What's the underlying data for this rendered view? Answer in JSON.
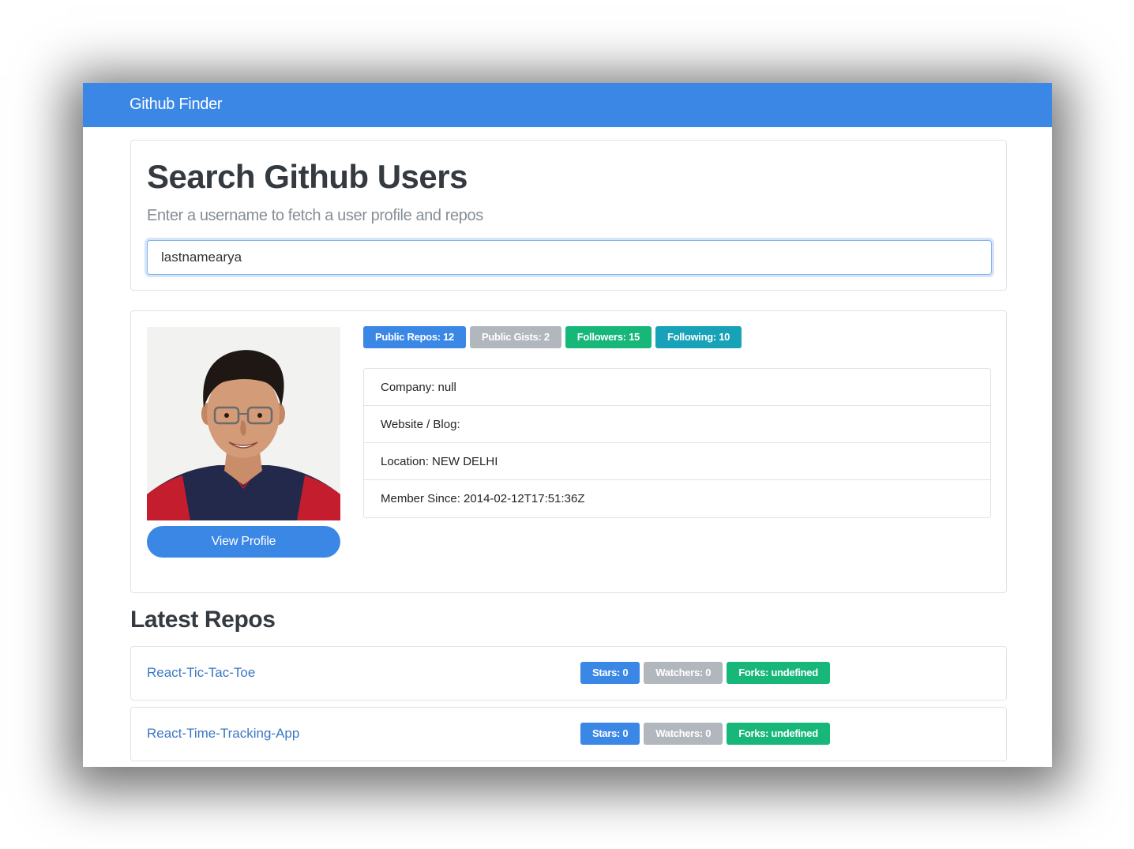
{
  "navbar": {
    "brand": "Github Finder"
  },
  "search": {
    "title": "Search Github Users",
    "subtitle": "Enter a username to fetch a user profile and repos",
    "value": "lastnamearya"
  },
  "profile": {
    "badges": {
      "public_repos": "Public Repos: 12",
      "public_gists": "Public Gists: 2",
      "followers": "Followers: 15",
      "following": "Following: 10"
    },
    "info": {
      "company": "Company: null",
      "website": "Website / Blog:",
      "location": "Location: NEW DELHI",
      "member_since": "Member Since: 2014-02-12T17:51:36Z"
    },
    "view_profile_label": "View Profile"
  },
  "repos": {
    "heading": "Latest Repos",
    "items": [
      {
        "name": "React-Tic-Tac-Toe",
        "stars": "Stars: 0",
        "watchers": "Watchers: 0",
        "forks": "Forks: undefined"
      },
      {
        "name": "React-Time-Tracking-App",
        "stars": "Stars: 0",
        "watchers": "Watchers: 0",
        "forks": "Forks: undefined"
      }
    ]
  },
  "colors": {
    "primary": "#3a87e6",
    "secondary": "#b1b7bd",
    "success": "#17b77a",
    "info": "#17a2b8"
  },
  "icons": {
    "avatar": "user-avatar-photo"
  }
}
